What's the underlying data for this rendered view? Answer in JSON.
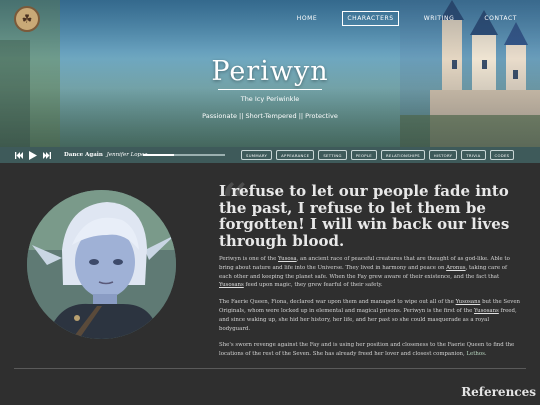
{
  "header": {
    "logo_glyph": "☘",
    "nav": [
      {
        "label": "HOME",
        "active": false
      },
      {
        "label": "CHARACTERS",
        "active": true
      },
      {
        "label": "WRITING",
        "active": false
      },
      {
        "label": "CONTACT",
        "active": false
      }
    ],
    "title": "Periwyn",
    "subtitle": "The Icy Periwinkle",
    "traits": "Passionate || Short-Tempered || Protective"
  },
  "player": {
    "prev_icon": "skip-back-icon",
    "play_icon": "play-icon",
    "next_icon": "skip-forward-icon",
    "song_title": "Dance Again",
    "song_artist": "Jennifer Lopez",
    "progress": 0.38
  },
  "tabs": [
    "SUMMARY",
    "APPEARANCE",
    "SETTING",
    "PEOPLE",
    "RELATIONSHIPS",
    "HISTORY",
    "TRIVIA",
    "CODES"
  ],
  "main": {
    "quote_mark": "“",
    "quote": "I refuse to let our people fade into the past, I refuse to let them be forgotten! I will win back our lives through blood.",
    "paragraphs": [
      {
        "parts": [
          {
            "t": "Periwyn is one of the "
          },
          {
            "t": "Yusosa",
            "u": true
          },
          {
            "t": ", an ancient race of peaceful creatures that are thought of as god-like. Able to bring about nature and life into the Universe. They lived in harmony and peace on "
          },
          {
            "t": "Aronus",
            "u": true
          },
          {
            "t": ", taking care of each other and keeping the planet safe. When the Fay grew aware of their existence, and the fact that "
          },
          {
            "t": "Yusosans",
            "u": true
          },
          {
            "t": " feed upon magic, they grew fearful of their safety."
          }
        ]
      },
      {
        "parts": [
          {
            "t": "The Faerie Queen, Fiona, declared war upon them and managed to wipe out all of the "
          },
          {
            "t": "Yusosans",
            "u": true
          },
          {
            "t": " but the Seven Originals, whom were locked up in elemental and magical prisons. Periwyn is the first of the "
          },
          {
            "t": "Yusosans",
            "u": true
          },
          {
            "t": " freed, and since waking up, she hid her history, her life, and her past so she could masquerade as a royal bodyguard."
          }
        ]
      },
      {
        "parts": [
          {
            "t": "She's sworn revenge against the Fay and is using her position and closeness to the Faerie Queen to find the locations of the rest of the Seven. She has already freed her lover and closest companion, "
          },
          {
            "t": "Lethos",
            "g": true
          },
          {
            "t": "."
          }
        ]
      }
    ],
    "references_label": "References"
  },
  "colors": {
    "background": "#2f2f2f",
    "bar": "#3e5a5a",
    "text": "#e6e6e6"
  }
}
